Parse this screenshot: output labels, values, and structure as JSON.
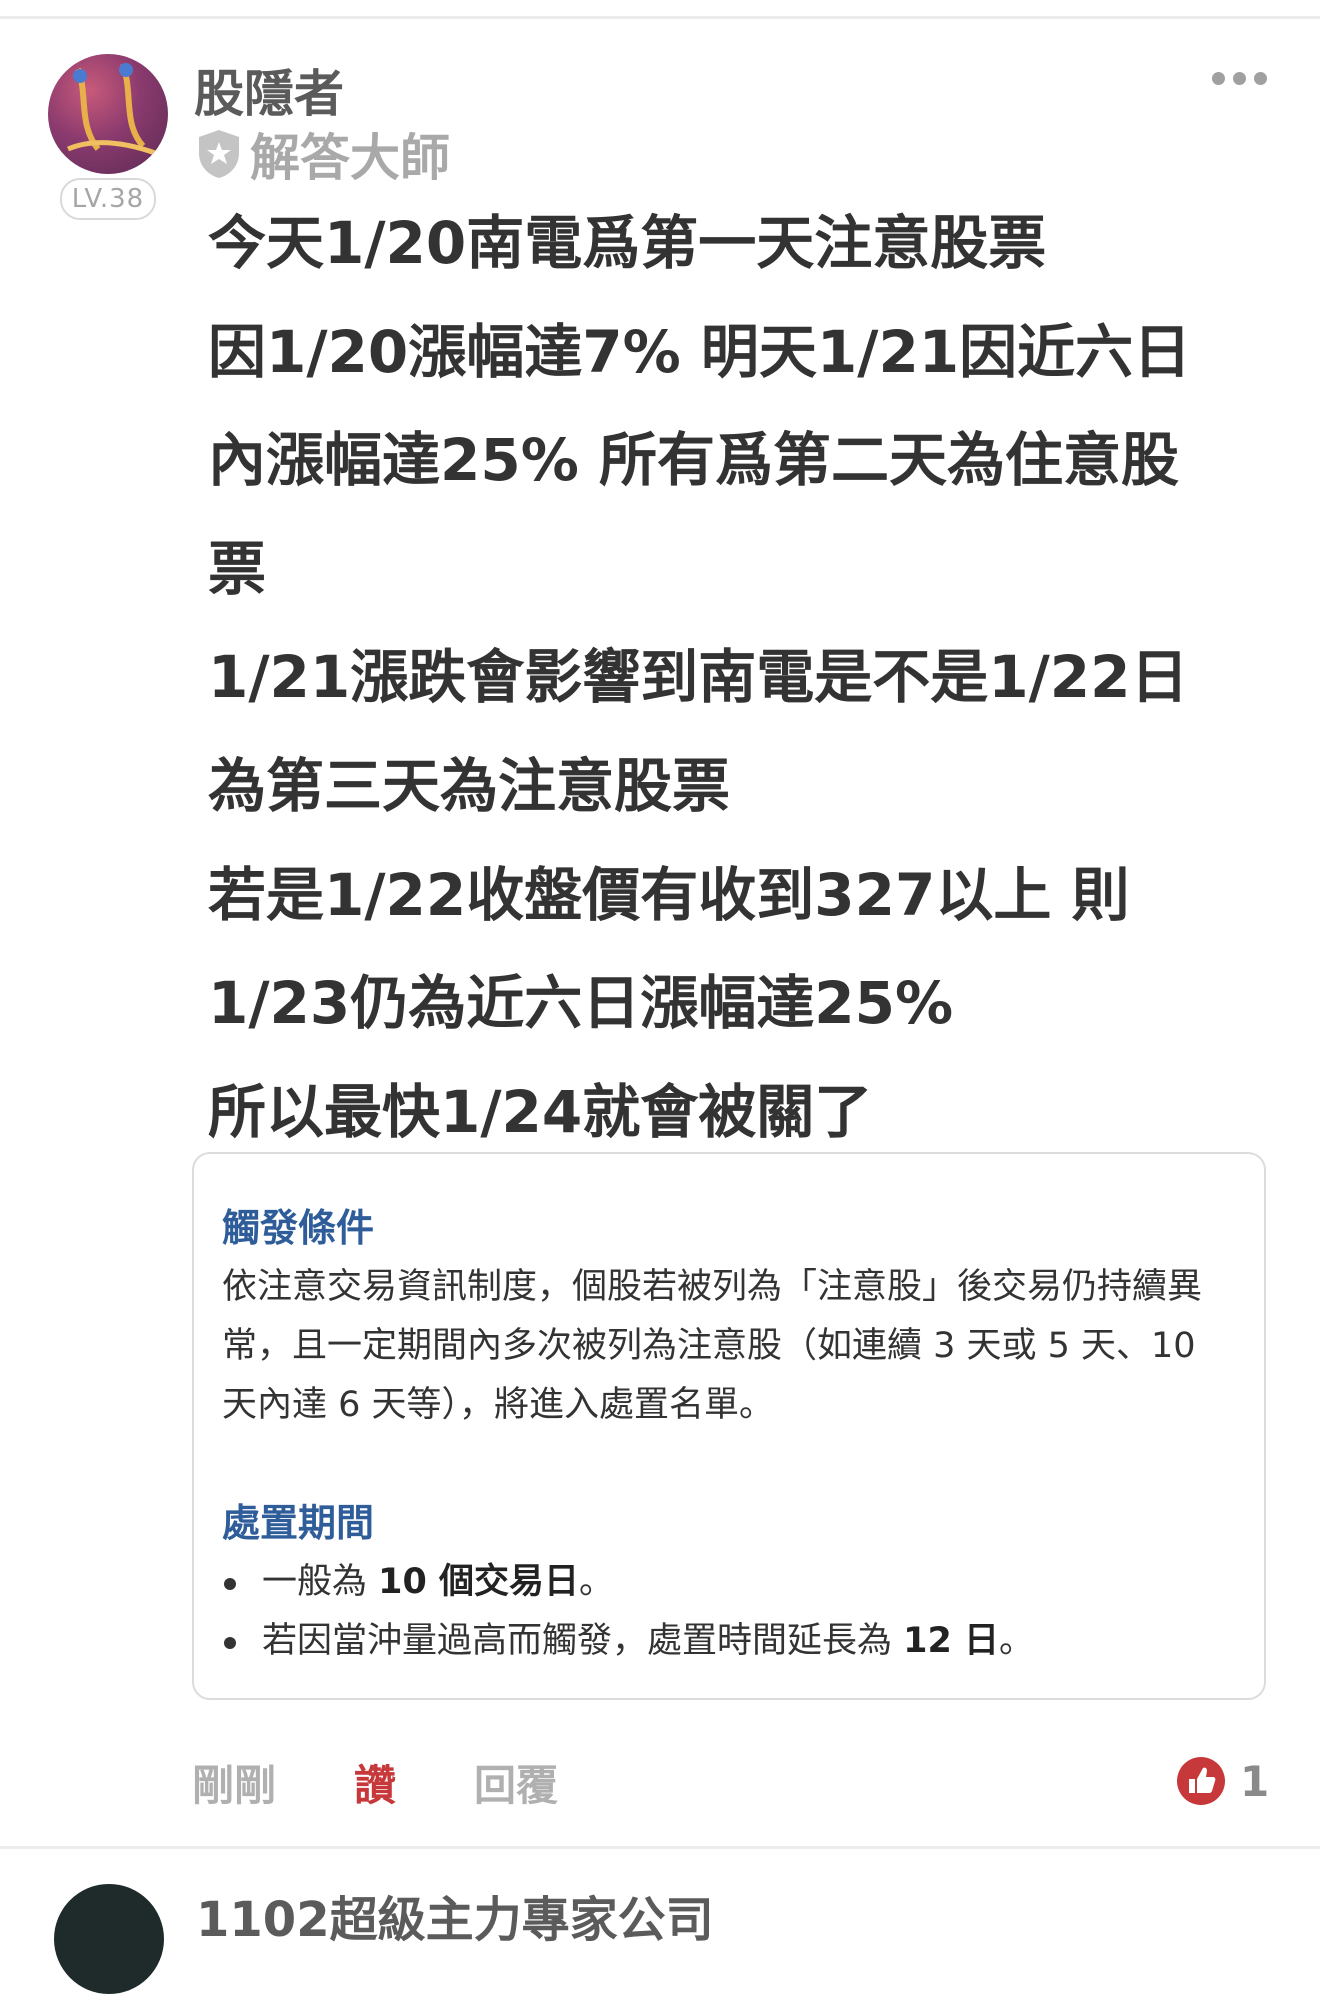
{
  "post": {
    "author": "股隱者",
    "author_title": "解答大師",
    "level": "LV.38",
    "lines": [
      "今天1/20南電爲第一天注意股票",
      "因1/20漲幅達7% 明天1/21因近六日",
      "內漲幅達25% 所有爲第二天為住意股",
      "票",
      "1/21漲跌會影響到南電是不是1/22日",
      "為第三天為注意股票",
      "若是1/22收盤價有收到327以上 則",
      "1/23仍為近六日漲幅達25%",
      "所以最快1/24就會被關了"
    ],
    "info_box": {
      "trigger_heading": "觸發條件",
      "trigger_text": "依注意交易資訊制度，個股若被列為「注意股」後交易仍持續異常，且一定期間內多次被列為注意股（如連續 3 天或 5 天、10 天內達 6 天等），將進入處置名單。",
      "period_heading": "處置期間",
      "bullet1_prefix": "一般為 ",
      "bullet1_bold": "10 個交易日",
      "bullet1_suffix": "。",
      "bullet2_prefix": "若因當沖量過高而觸發，處置時間延長為 ",
      "bullet2_bold": "12 日",
      "bullet2_suffix": "。"
    },
    "time": "剛剛",
    "like_label": "讚",
    "reply_label": "回覆",
    "like_count": "1"
  },
  "next_post": {
    "author_partial": "1102超級主力專家公司"
  },
  "colors": {
    "like_red": "#c6383a",
    "heading_blue": "#2f5d9a",
    "muted_gray": "#b0b0b0"
  },
  "icons": {
    "menu": "more-horizontal-icon",
    "title_badge": "shield-icon",
    "like_badge": "thumbs-up-icon"
  }
}
